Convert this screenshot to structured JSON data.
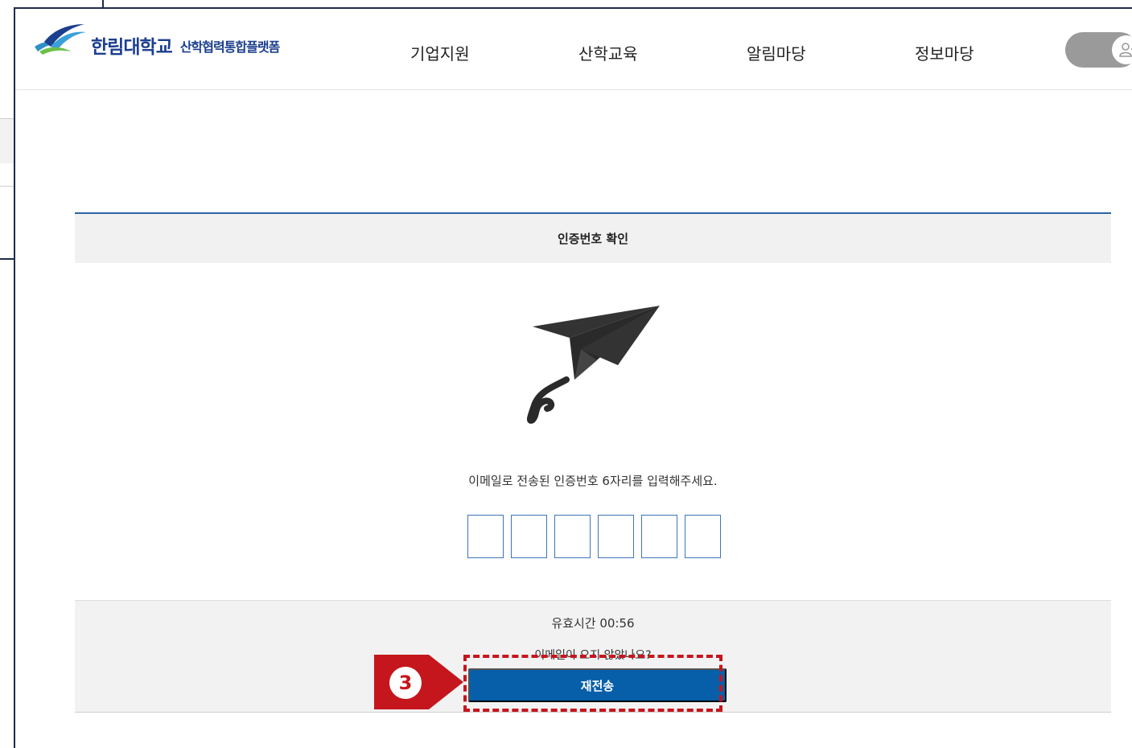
{
  "header": {
    "logo_university": "한림대학교",
    "logo_subtitle": "산학협력통합플랫폼",
    "nav": [
      "기업지원",
      "산학교육",
      "알림마당",
      "정보마당"
    ],
    "user_toggle_icon": "user-icon"
  },
  "verification": {
    "title": "인증번호 확인",
    "illustration": "paper-plane-icon",
    "instruction": "이메일로 전송된 인증번호 6자리를 입력해주세요.",
    "code_digits": [
      "",
      "",
      "",
      "",
      "",
      ""
    ],
    "timer_text": "유효시간 00:56",
    "no_email_text": "이메일이 오지 않았나요?",
    "resend_label": "재전송"
  },
  "annotation": {
    "step_number": "3",
    "color": "#c5161d"
  },
  "colors": {
    "brand_blue": "#1c3f8f",
    "button_blue": "#075fa9",
    "input_border": "#3d76b8"
  }
}
